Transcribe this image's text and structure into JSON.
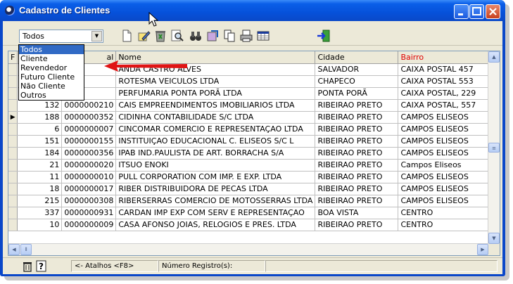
{
  "window": {
    "title": "Cadastro de Clientes"
  },
  "toolbar": {
    "filter_value": "Todos",
    "icons": [
      "new-document-icon",
      "edit-icon",
      "delete-icon",
      "search-icon",
      "binoculars-icon",
      "refresh-icon",
      "copy-icon",
      "print-icon",
      "grid-icon",
      "exit-icon"
    ]
  },
  "dropdown": {
    "options": [
      "Todos",
      "Cliente",
      "Revendedor",
      "Futuro Cliente",
      "Não Cliente",
      "Outros"
    ],
    "selected": 0
  },
  "grid": {
    "columns": [
      "F",
      "",
      "al",
      "Nome",
      "Cidade",
      "Bairro"
    ],
    "rows": [
      [
        "",
        "",
        "",
        "ANDA CASTRO ALVES",
        "SALVADOR",
        "CAIXA POSTAL 457"
      ],
      [
        "",
        "",
        "",
        "ROTESMA VEICULOS LTDA",
        "CHAPECO",
        "CAIXA POSTAL 553"
      ],
      [
        "",
        "",
        "",
        "PERFUMARIA PONTA PORÃ LTDA",
        "PONTA PORÃ",
        "CAIXA POSTAL, 229"
      ],
      [
        "132",
        "0000000210",
        "",
        "CAIS EMPREENDIMENTOS IMOBILIARIOS LTDA",
        "RIBEIRAO PRETO",
        "CAIXA POSTAL, 557"
      ],
      [
        "188",
        "0000000352",
        "",
        "CIDINHA CONTABILIDADE S/C LTDA",
        "RIBEIRAO PRETO",
        "CAMPOS ELISEOS"
      ],
      [
        "6",
        "0000000007",
        "",
        "CINCOMAR COMERCIO E REPRESENTAÇAO LTDA",
        "RIBEIRAO PRETO",
        "CAMPOS ELISEOS"
      ],
      [
        "151",
        "0000000155",
        "",
        "INSTITUIÇAO EDUCACIONAL C. ELISEOS S/C L",
        "RIBEIRAO PRETO",
        "CAMPOS ELISEOS"
      ],
      [
        "184",
        "0000000356",
        "",
        "IPAB IND.PAULISTA DE ART. BORRACHA S/A",
        "RIBEIRAO PRETO",
        "CAMPOS ELISEOS"
      ],
      [
        "21",
        "0000000020",
        "",
        "ITSUO ENOKI",
        "RIBEIRAO PRETO",
        "Campos Eliseos"
      ],
      [
        "11",
        "0000000010",
        "",
        "PULL CORPORATION COM IMP. E EXP. LTDA",
        "RIBEIRAO PRETO",
        "CAMPOS ELISEOS"
      ],
      [
        "18",
        "0000000017",
        "",
        "RIBER DISTRIBUIDORA DE PECAS LTDA",
        "RIBEIRAO PRETO",
        "CAMPOS ELISEOS"
      ],
      [
        "215",
        "0000000308",
        "",
        "RIBERSERRAS COMERCIO DE MOTOSSERRAS LTDA",
        "RIBEIRAO PRETO",
        "CAMPOS ELISEOS"
      ],
      [
        "337",
        "0000000931",
        "",
        "CARDAN IMP EXP COM SERV E REPRESENTAÇAO",
        "BOA VISTA",
        "CENTRO"
      ],
      [
        "10",
        "0000000009",
        "",
        "CASA AFONSO JOIAS, RELOGIOS E PRES. LTDA",
        "RIBEIRAO PRETO",
        "CENTRO"
      ]
    ],
    "current_row": 4
  },
  "status": {
    "shortcuts": "<- Atalhos <F8>",
    "record_label": "Número Registro(s):"
  },
  "colors": {
    "title_bar": "#0a55d8",
    "arrow": "#e01414",
    "header_red": "#e00000",
    "selection": "#316ac5"
  }
}
